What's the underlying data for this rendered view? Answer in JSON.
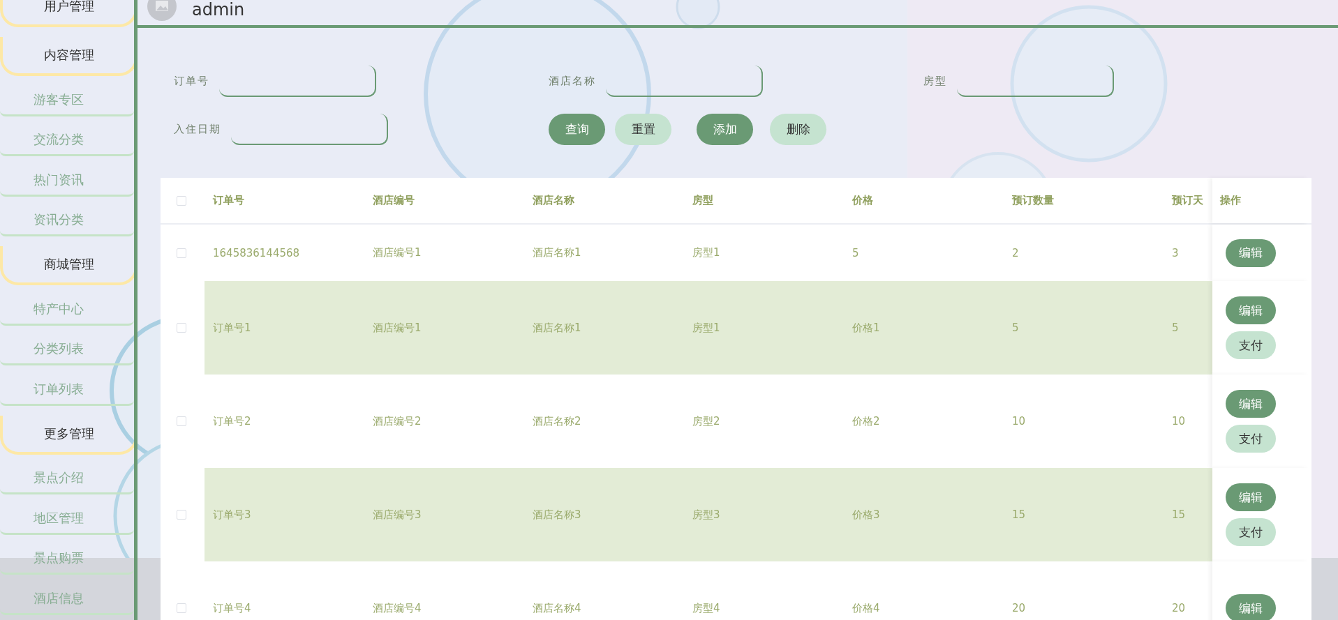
{
  "sidebar": {
    "groups": [
      {
        "title": "用户管理"
      },
      {
        "title": "内容管理",
        "items": [
          "游客专区",
          "交流分类",
          "热门资讯",
          "资讯分类"
        ]
      },
      {
        "title": "商城管理",
        "items": [
          "特产中心",
          "分类列表",
          "订单列表"
        ]
      },
      {
        "title": "更多管理",
        "items": [
          "景点介绍",
          "地区管理",
          "景点购票",
          "酒店信息"
        ]
      }
    ]
  },
  "header": {
    "username": "admin"
  },
  "search": {
    "fields": [
      {
        "label": "订单号"
      },
      {
        "label": "酒店名称"
      },
      {
        "label": "房型"
      },
      {
        "label": "入住日期"
      }
    ],
    "buttons": [
      {
        "label": "查询",
        "kind": "primary"
      },
      {
        "label": "重置",
        "kind": "secondary"
      },
      {
        "label": "添加",
        "kind": "primary"
      },
      {
        "label": "删除",
        "kind": "secondary"
      }
    ]
  },
  "table": {
    "select_all": {
      "checked": false
    },
    "columns": [
      "订单号",
      "酒店编号",
      "酒店名称",
      "房型",
      "价格",
      "预订数量",
      "预订天",
      "操作"
    ],
    "rows": [
      {
        "checked": false,
        "cells": [
          "1645836144568",
          "酒店编号1",
          "酒店名称1",
          "房型1",
          "5",
          "2",
          "3"
        ],
        "actions": [
          {
            "label": "编辑",
            "kind": "primary"
          }
        ]
      },
      {
        "checked": false,
        "cells": [
          "订单号1",
          "酒店编号1",
          "酒店名称1",
          "房型1",
          "价格1",
          "5",
          "5"
        ],
        "actions": [
          {
            "label": "编辑",
            "kind": "primary"
          },
          {
            "label": "支付",
            "kind": "secondary"
          }
        ]
      },
      {
        "checked": false,
        "cells": [
          "订单号2",
          "酒店编号2",
          "酒店名称2",
          "房型2",
          "价格2",
          "10",
          "10"
        ],
        "actions": [
          {
            "label": "编辑",
            "kind": "primary"
          },
          {
            "label": "支付",
            "kind": "secondary"
          }
        ]
      },
      {
        "checked": false,
        "cells": [
          "订单号3",
          "酒店编号3",
          "酒店名称3",
          "房型3",
          "价格3",
          "15",
          "15"
        ],
        "actions": [
          {
            "label": "编辑",
            "kind": "primary"
          },
          {
            "label": "支付",
            "kind": "secondary"
          }
        ]
      },
      {
        "checked": false,
        "cells": [
          "订单号4",
          "酒店编号4",
          "酒店名称4",
          "房型4",
          "价格4",
          "20",
          "20"
        ],
        "actions": [
          {
            "label": "编辑",
            "kind": "primary"
          }
        ]
      }
    ]
  }
}
